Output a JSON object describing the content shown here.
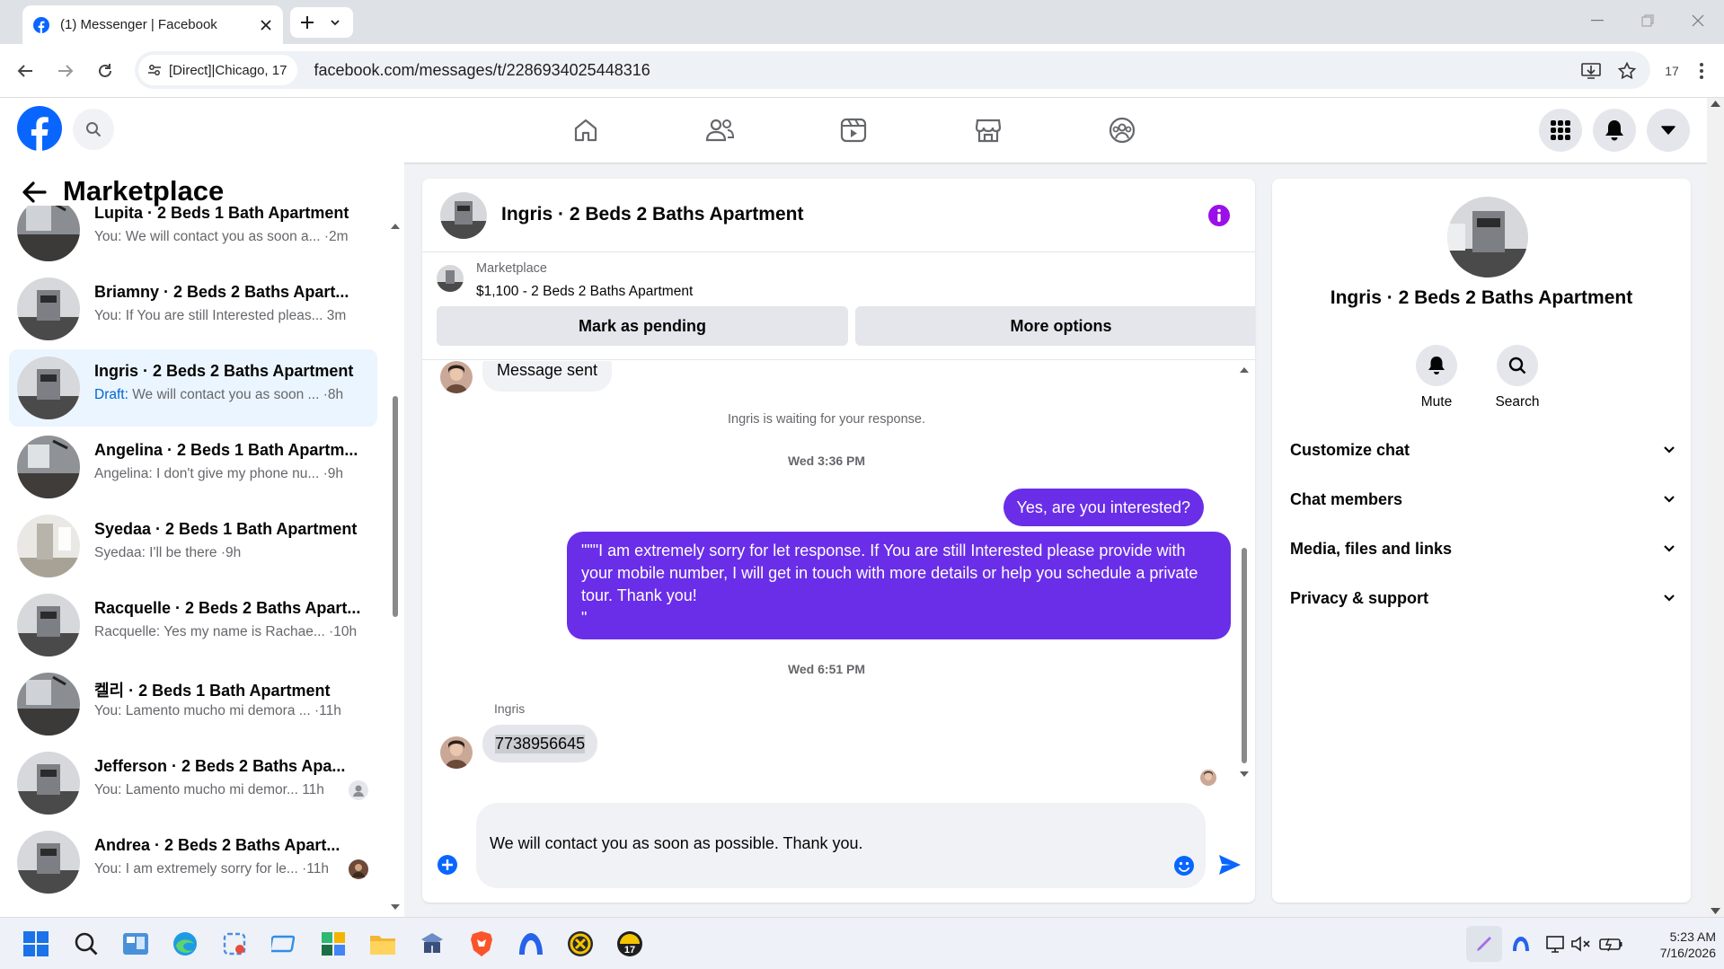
{
  "browser": {
    "tab_title": "(1) Messenger | Facebook",
    "site_info": "[Direct]|Chicago, 17",
    "url": "facebook.com/messages/t/2286934025448316",
    "extension_count": "17"
  },
  "sidebar": {
    "title": "Marketplace",
    "conversations": [
      {
        "name": "Lupita · 2 Beds 1 Bath Apartment",
        "preview": "You: We will contact you as soon a... ·2m",
        "draft": ""
      },
      {
        "name": "Briamny · 2 Beds 2 Baths Apart...",
        "preview": "You: If You are still Interested pleas... 3m",
        "draft": ""
      },
      {
        "name": "Ingris · 2 Beds 2 Baths Apartment",
        "preview": " We will contact you as soon ... ·8h",
        "draft": "Draft:"
      },
      {
        "name": "Angelina · 2 Beds 1 Bath Apartm...",
        "preview": "Angelina: I don't give my phone nu... ·9h",
        "draft": ""
      },
      {
        "name": "Syedaa · 2 Beds 1 Bath Apartment",
        "preview": "Syedaa: I'll be there ·9h",
        "draft": ""
      },
      {
        "name": "Racquelle · 2 Beds 2 Baths Apart...",
        "preview": "Racquelle: Yes my name is Rachae... ·10h",
        "draft": ""
      },
      {
        "name": "켈리 · 2 Beds 1 Bath Apartment",
        "preview": "You: Lamento mucho mi demora ... ·11h",
        "draft": ""
      },
      {
        "name": "Jefferson · 2 Beds 2 Baths Apa...",
        "preview": "You: Lamento mucho mi demor... 11h",
        "draft": ""
      },
      {
        "name": "Andrea · 2 Beds 2 Baths Apart...",
        "preview": "You: I am extremely sorry for le... ·11h",
        "draft": ""
      }
    ]
  },
  "chat": {
    "header_name": "Ingris · 2 Beds 2 Baths Apartment",
    "listing_source": "Marketplace",
    "listing_title": "$1,100 - 2 Beds 2 Baths Apartment",
    "mark_pending": "Mark as pending",
    "more_options": "More options",
    "message_sent": "Message sent",
    "waiting": "Ingris is waiting for your response.",
    "ts1": "Wed 3:36 PM",
    "sent1": "Yes, are you interested?",
    "sent2": "\"\"\"I am extremely sorry for let response. If You are still Interested please provide with your mobile number, I will get in touch with more details or help you schedule a private tour. Thank you!\n\"",
    "ts2": "Wed 6:51 PM",
    "sender": "Ingris",
    "received": "7738956645",
    "composer_text": "We will contact you as soon as possible. Thank you."
  },
  "details": {
    "name": "Ingris · 2 Beds 2 Baths Apartment",
    "mute": "Mute",
    "search": "Search",
    "sections": [
      "Customize chat",
      "Chat members",
      "Media, files and links",
      "Privacy & support"
    ]
  },
  "taskbar": {
    "time": "5:23 AM",
    "date": "7/16/2026"
  },
  "colors": {
    "fb_blue": "#0866ff",
    "messenger_purple": "#6a2ee8",
    "active_bg": "#ebf5ff"
  }
}
